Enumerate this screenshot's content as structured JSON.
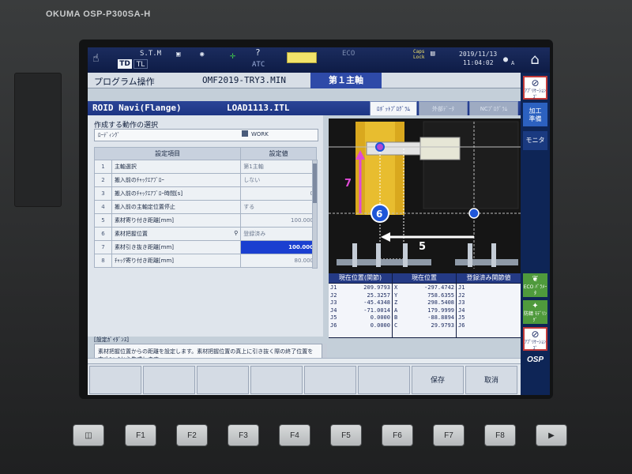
{
  "brand": "OKUMA OSP-P300SA-H",
  "status": {
    "stm": "S.T.M",
    "td": "TD",
    "tl": "TL",
    "atc": "ATC",
    "eco": "ECO",
    "caps_lock": "Caps Lock",
    "date": "2019/11/13",
    "time": "11:04:02",
    "user": "A"
  },
  "header": {
    "title": "プログラム操作",
    "file": "OMF2019-TRY3.MIN",
    "spindle": "第１主軸"
  },
  "navi": {
    "title": "ROID Navi(Flange)",
    "file": "LOAD1113.ITL",
    "tabs": [
      "ﾛﾎﾞｯﾄﾌﾟﾛｸﾞﾗﾑ",
      "外部ﾃﾞｰﾀ",
      "NCﾌﾟﾛｸﾞﾗﾑ"
    ]
  },
  "motion": {
    "label": "作成する動作の選択",
    "value": "ﾛｰﾃﾞｨﾝｸﾞ",
    "work_label": "WORK"
  },
  "settings": {
    "col_item": "設定項目",
    "col_value": "設定値",
    "rows": [
      {
        "num": "1",
        "name": "主軸選択",
        "value": "第1主軸"
      },
      {
        "num": "2",
        "name": "搬入前のﾁｬｯｸｴｱﾌﾞﾛｰ",
        "value": "しない"
      },
      {
        "num": "3",
        "name": "搬入前のﾁｬｯｸｴｱﾌﾞﾛｰ時間[s]",
        "value": "0"
      },
      {
        "num": "4",
        "name": "搬入前の主軸定位置停止",
        "value": "する"
      },
      {
        "num": "5",
        "name": "素材寄り付き距離[mm]",
        "value": "100.000"
      },
      {
        "num": "6",
        "name": "素材把握位置",
        "value": "登録済み"
      },
      {
        "num": "7",
        "name": "素材引き抜き距離[mm]",
        "value": "100.000"
      },
      {
        "num": "8",
        "name": "ﾁｬｯｸ寄り付き距離[mm]",
        "value": "80.000"
      }
    ]
  },
  "guidance": {
    "label": "[設定ｶﾞｲﾀﾞﾝｽ]",
    "text": "素材把握位置からの距離を設定します。素材把握位置の真上に引き抜く際の終了位置を本ﾊﾟﾗﾒｰﾀから生成します。"
  },
  "diagram": {
    "label_7": "7",
    "label_6": "6",
    "label_5": "5"
  },
  "positions": {
    "headers": [
      "現在位置(関節)",
      "現在位置",
      "登録済み関節値"
    ],
    "joint": [
      {
        "axis": "J1",
        "value": "209.9793"
      },
      {
        "axis": "J2",
        "value": "25.3257"
      },
      {
        "axis": "J3",
        "value": "-45.4348"
      },
      {
        "axis": "J4",
        "value": "-71.0014"
      },
      {
        "axis": "J5",
        "value": "0.0000"
      },
      {
        "axis": "J6",
        "value": "0.0000"
      }
    ],
    "cart": [
      {
        "axis": "X",
        "value": "-297.4742"
      },
      {
        "axis": "Y",
        "value": "758.6355"
      },
      {
        "axis": "Z",
        "value": "298.5408"
      },
      {
        "axis": "A",
        "value": "179.9999"
      },
      {
        "axis": "B",
        "value": "-88.8894"
      },
      {
        "axis": "C",
        "value": "29.9793"
      }
    ],
    "registered": [
      {
        "axis": "J1",
        "value": ""
      },
      {
        "axis": "J2",
        "value": ""
      },
      {
        "axis": "J3",
        "value": ""
      },
      {
        "axis": "J4",
        "value": ""
      },
      {
        "axis": "J5",
        "value": ""
      },
      {
        "axis": "J6",
        "value": ""
      }
    ]
  },
  "sidepanel": {
    "app_suite": "ｱﾌﾟﾘｹｰｼｮﾝｽﾞ",
    "kakou": "加工",
    "junbi": "準備",
    "monitor": "モニタ",
    "eco_param": "ECO ﾊﾟﾗﾒｰﾀ",
    "kanrei": "防錆 ﾓﾃﾞﾘﾝｸﾞ",
    "app_suite2": "ｱﾌﾟﾘｹｰｼｮﾝｽﾞ",
    "osp": "OSP"
  },
  "softkeys": [
    "",
    "",
    "",
    "",
    "",
    "",
    "保存",
    "取消"
  ],
  "fkeys": [
    "",
    "F1",
    "F2",
    "F3",
    "F4",
    "F5",
    "F6",
    "F7",
    "F8",
    "▶"
  ]
}
